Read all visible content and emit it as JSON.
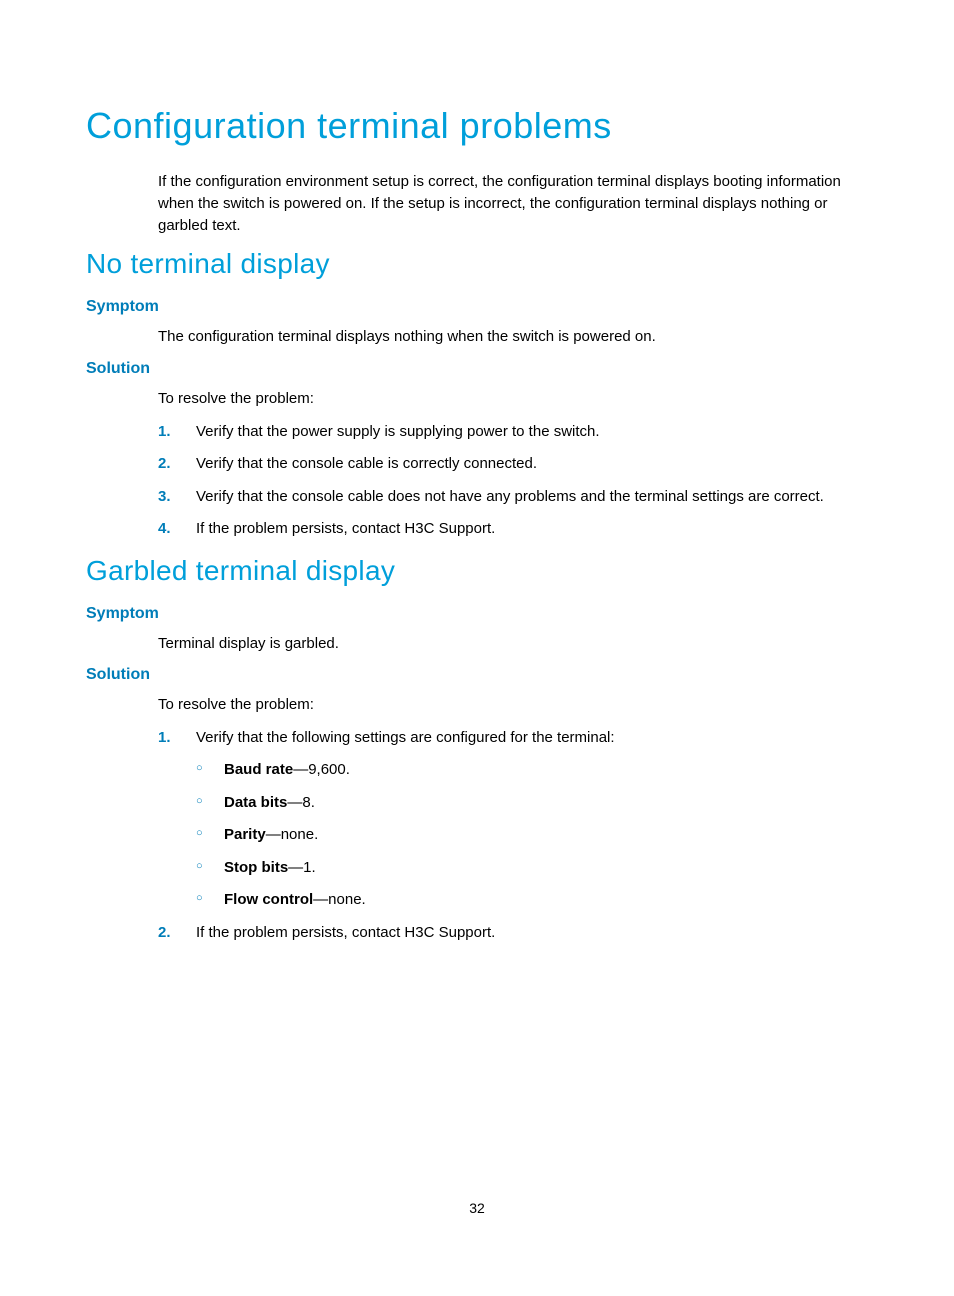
{
  "headings": {
    "h1": "Configuration terminal problems",
    "intro": "If the configuration environment setup is correct, the configuration terminal displays booting information when the switch is powered on. If the setup is incorrect, the configuration terminal displays nothing or garbled text.",
    "section1": {
      "title": "No terminal display",
      "symptom_label": "Symptom",
      "symptom_text": "The configuration terminal displays nothing when the switch is powered on.",
      "solution_label": "Solution",
      "solution_intro": "To resolve the problem:",
      "steps": [
        "Verify that the power supply is supplying power to the switch.",
        "Verify that the console cable is correctly connected.",
        "Verify that the console cable does not have any problems and the terminal settings are correct.",
        "If the problem persists, contact H3C Support."
      ]
    },
    "section2": {
      "title": "Garbled terminal display",
      "symptom_label": "Symptom",
      "symptom_text": "Terminal display is garbled.",
      "solution_label": "Solution",
      "solution_intro": "To resolve the problem:",
      "step1_text": "Verify that the following settings are configured for the terminal:",
      "settings": [
        {
          "label": "Baud rate",
          "value": "—9,600."
        },
        {
          "label": "Data bits",
          "value": "—8."
        },
        {
          "label": "Parity",
          "value": "—none."
        },
        {
          "label": "Stop bits",
          "value": "—1."
        },
        {
          "label": "Flow control",
          "value": "—none."
        }
      ],
      "step2_text": "If the problem persists, contact H3C Support."
    }
  },
  "page_number": "32",
  "nums": {
    "n1": "1.",
    "n2": "2.",
    "n3": "3.",
    "n4": "4."
  },
  "bullet": "○"
}
